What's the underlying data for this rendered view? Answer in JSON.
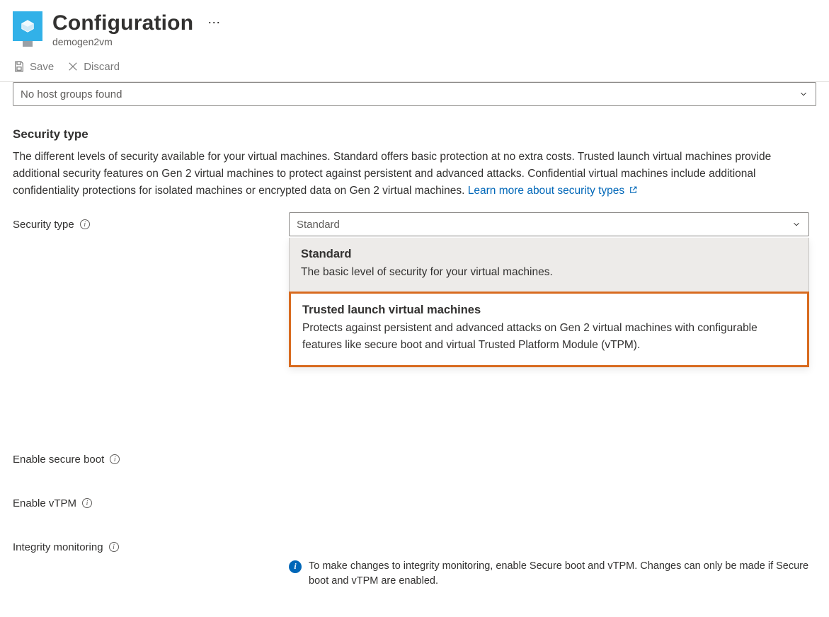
{
  "header": {
    "title": "Configuration",
    "subtitle": "demogen2vm"
  },
  "toolbar": {
    "save_label": "Save",
    "discard_label": "Discard"
  },
  "host_dropdown": {
    "selected": "No host groups found"
  },
  "security_section": {
    "heading": "Security type",
    "description": "The different levels of security available for your virtual machines. Standard offers basic protection at no extra costs. Trusted launch virtual machines provide additional security features on Gen 2 virtual machines to protect against persistent and advanced attacks. Confidential virtual machines include additional confidentiality protections for isolated machines or encrypted data on Gen 2 virtual machines. ",
    "learn_more_label": "Learn more about security types"
  },
  "form": {
    "security_type_label": "Security type",
    "enable_secure_boot_label": "Enable secure boot",
    "enable_vtpm_label": "Enable vTPM",
    "integrity_monitoring_label": "Integrity monitoring"
  },
  "security_type_dropdown": {
    "selected": "Standard",
    "options": [
      {
        "title": "Standard",
        "desc": "The basic level of security for your virtual machines."
      },
      {
        "title": "Trusted launch virtual machines",
        "desc": "Protects against persistent and advanced attacks on Gen 2 virtual machines with configurable features like secure boot and virtual Trusted Platform Module (vTPM)."
      }
    ]
  },
  "integrity_info": "To make changes to integrity monitoring, enable Secure boot and vTPM. Changes can only be made if Secure boot and vTPM are enabled."
}
